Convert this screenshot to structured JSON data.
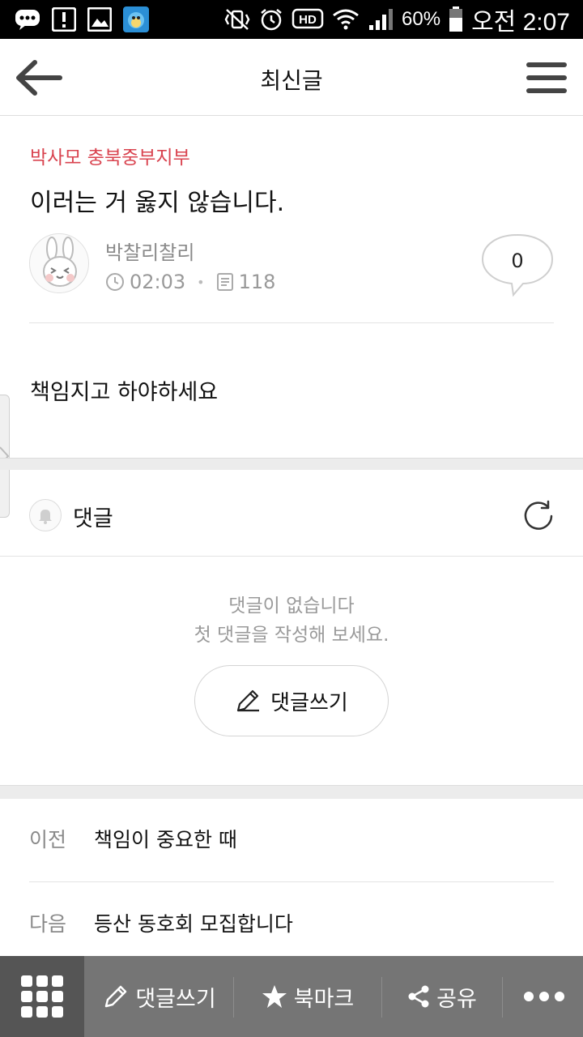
{
  "status_bar": {
    "battery": "60%",
    "time": "오전 2:07",
    "icons": [
      "chat-icon",
      "alert-icon",
      "image-icon",
      "app-avatar-icon",
      "vibrate-mute-icon",
      "alarm-icon",
      "hd-icon",
      "wifi-icon",
      "signal-icon",
      "battery-icon"
    ],
    "hd_label": "HD"
  },
  "header": {
    "title": "최신글",
    "back_icon": "arrow-left-icon",
    "menu_icon": "hamburger-menu-icon"
  },
  "post": {
    "board": "박사모 충북중부지부",
    "title": "이러는 거 옳지 않습니다.",
    "author": "박찰리찰리",
    "time": "02:03",
    "views": "118",
    "comment_count": "0",
    "body": "책임지고 하야하세요"
  },
  "comments": {
    "title": "댓글",
    "empty_line1": "댓글이 없습니다",
    "empty_line2": "첫 댓글을 작성해 보세요.",
    "write_label": "댓글쓰기"
  },
  "navigation": {
    "prev_label": "이전",
    "prev_title": "책임이 중요한 때",
    "next_label": "다음",
    "next_title": "등산 동호회 모집합니다"
  },
  "toolbar": {
    "comment_label": "댓글쓰기",
    "bookmark_label": "북마크",
    "share_label": "공유"
  },
  "colors": {
    "board_accent": "#d9434f",
    "toolbar_bg": "#757575",
    "toolbar_grid_bg": "#555555"
  }
}
